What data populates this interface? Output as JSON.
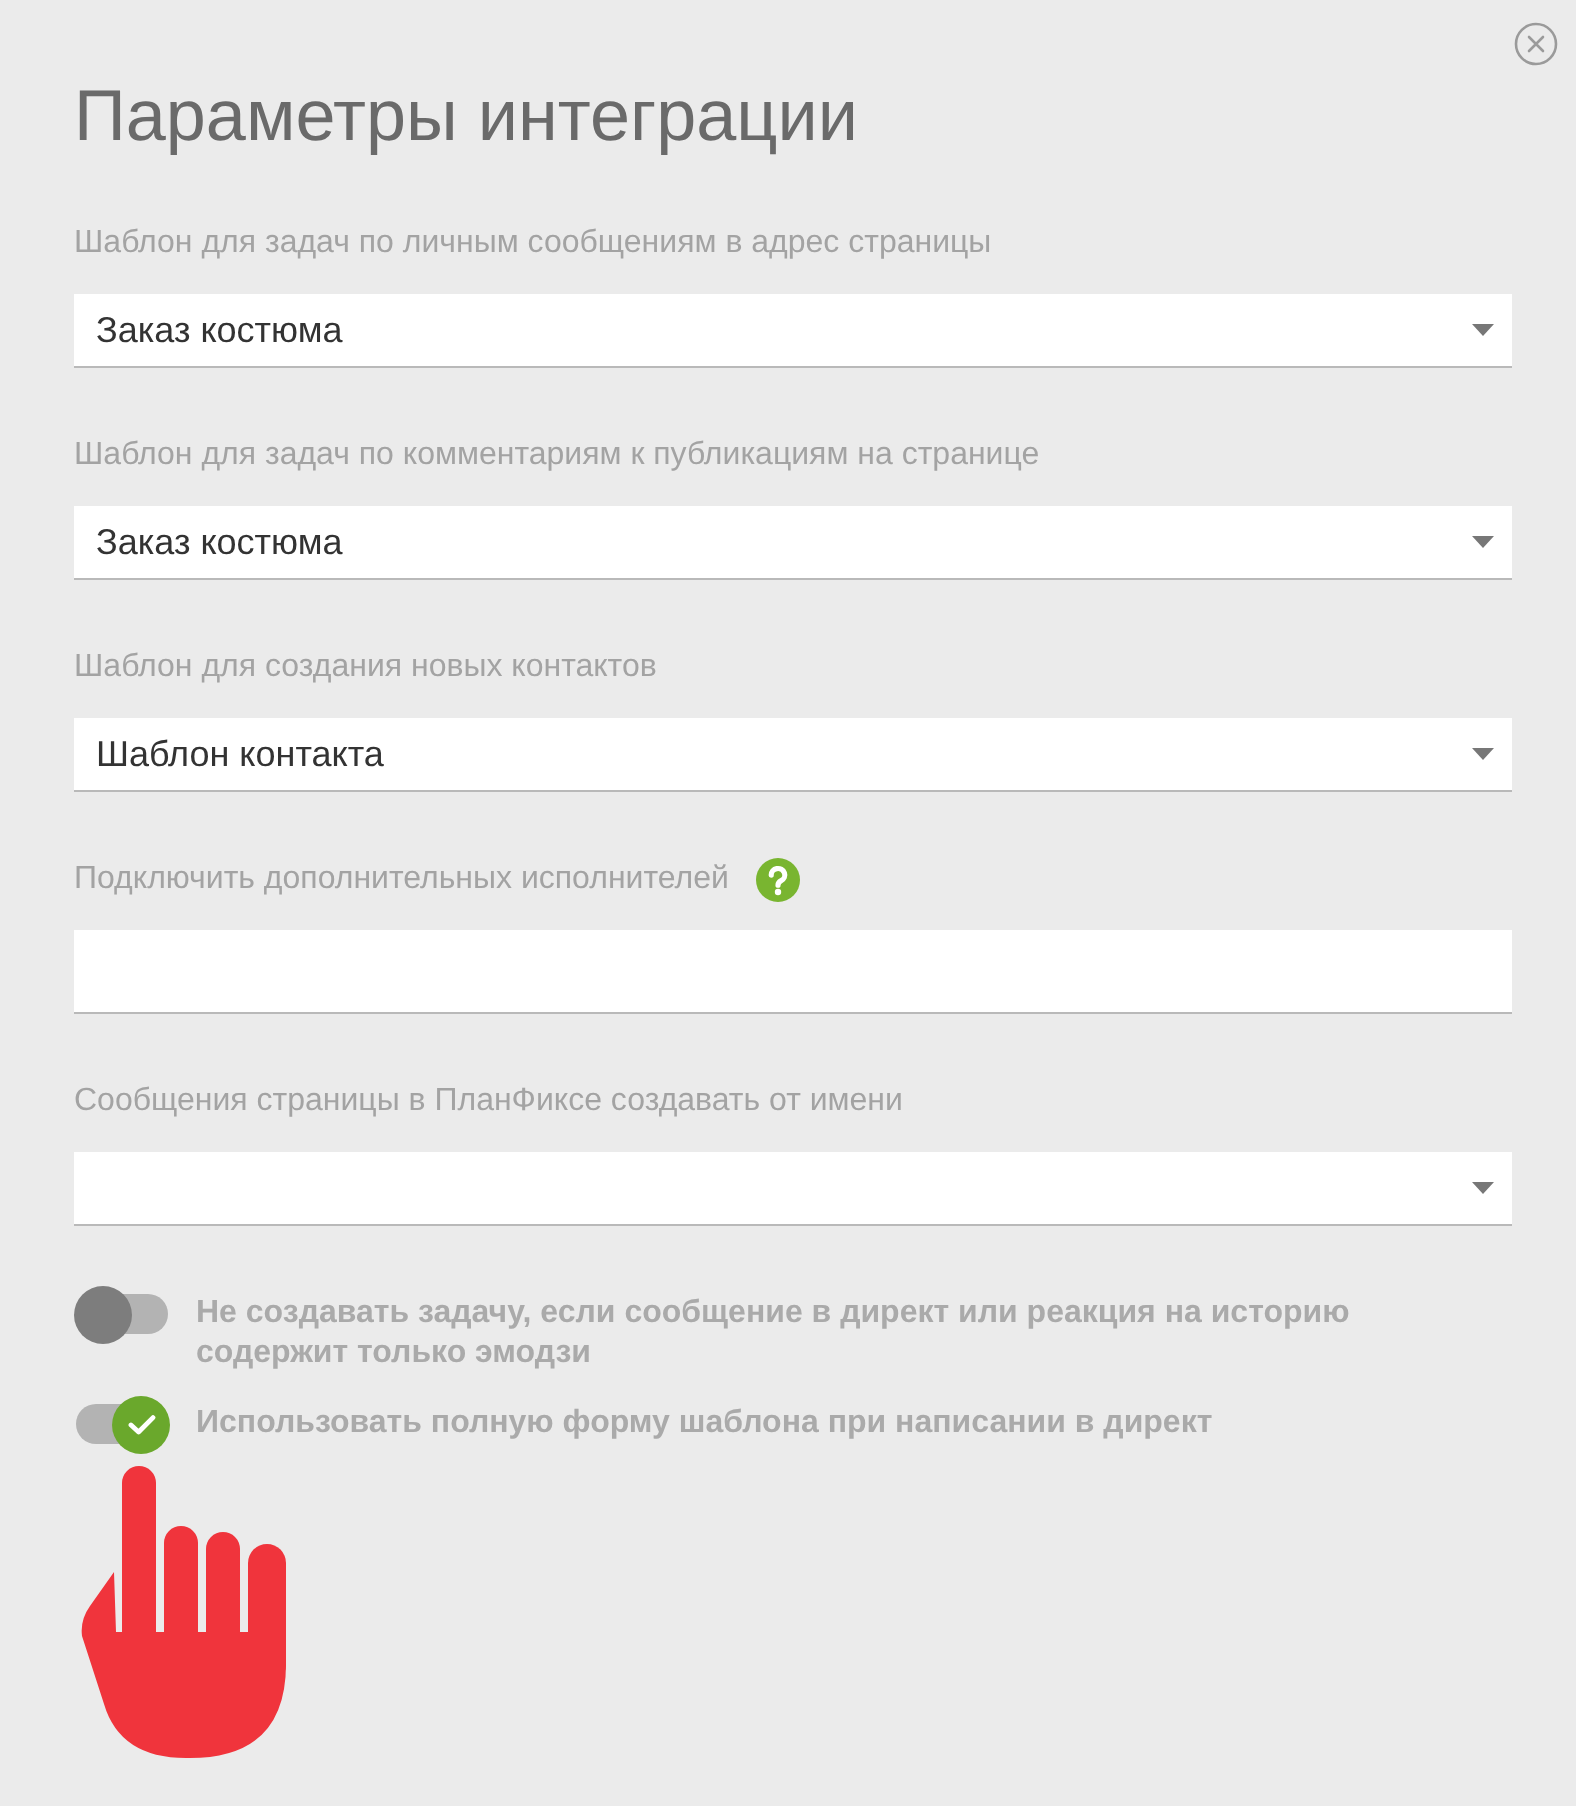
{
  "dialog": {
    "title": "Параметры интеграции"
  },
  "fields": [
    {
      "kind": "select",
      "label": "Шаблон для задач по личным сообщениям в адрес страницы",
      "value": "Заказ костюма",
      "help": false
    },
    {
      "kind": "select",
      "label": "Шаблон для задач по комментариям к публикациям на странице",
      "value": "Заказ костюма",
      "help": false
    },
    {
      "kind": "select",
      "label": "Шаблон для создания новых контактов",
      "value": "Шаблон контакта",
      "help": false
    },
    {
      "kind": "text",
      "label": "Подключить дополнительных исполнителей",
      "help": true
    },
    {
      "kind": "select",
      "label": "Сообщения страницы в ПланФиксе создавать от имени",
      "help": false
    }
  ],
  "toggles": [
    {
      "label": "Не создавать задачу, если сообщение в директ или реакция на историю содержит только эмодзи",
      "on": false
    },
    {
      "label": "Использовать полную форму шаблона при написании в директ",
      "on": true
    }
  ]
}
